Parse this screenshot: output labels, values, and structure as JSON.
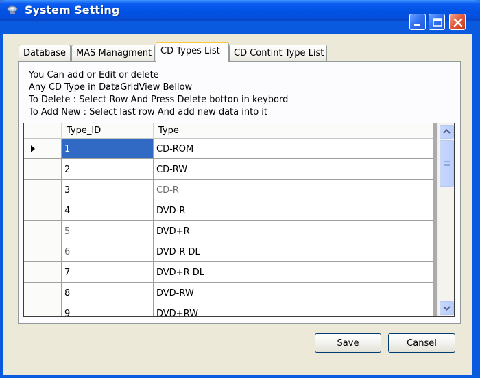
{
  "window": {
    "title": "System Setting"
  },
  "tabs": [
    {
      "label": "Database",
      "active": false
    },
    {
      "label": "MAS Managment",
      "active": false
    },
    {
      "label": "CD Types List",
      "active": true
    },
    {
      "label": "CD Contint Type List",
      "active": false
    }
  ],
  "instructions": [
    "You Can add or Edit or delete",
    "Any CD Type in DataGridView Bellow",
    "To Delete : Select Row And Press Delete botton in keybord",
    "To Add New : Select last row And add new data into it"
  ],
  "grid": {
    "columns": [
      "Type_ID",
      "Type"
    ],
    "rows": [
      {
        "id": "1",
        "type": "CD-ROM"
      },
      {
        "id": "2",
        "type": "CD-RW"
      },
      {
        "id": "3",
        "type": "CD-R"
      },
      {
        "id": "4",
        "type": "DVD-R"
      },
      {
        "id": "5",
        "type": "DVD+R"
      },
      {
        "id": "6",
        "type": "DVD-R DL"
      },
      {
        "id": "7",
        "type": "DVD+R DL"
      },
      {
        "id": "8",
        "type": "DVD-RW"
      },
      {
        "id": "9",
        "type": "DVD+RW"
      }
    ]
  },
  "buttons": {
    "save": "Save",
    "cancel": "Cansel"
  },
  "colors": {
    "titlebar": "#0053e4",
    "selection": "#316ac5",
    "tab_highlight": "#ffc83c"
  }
}
